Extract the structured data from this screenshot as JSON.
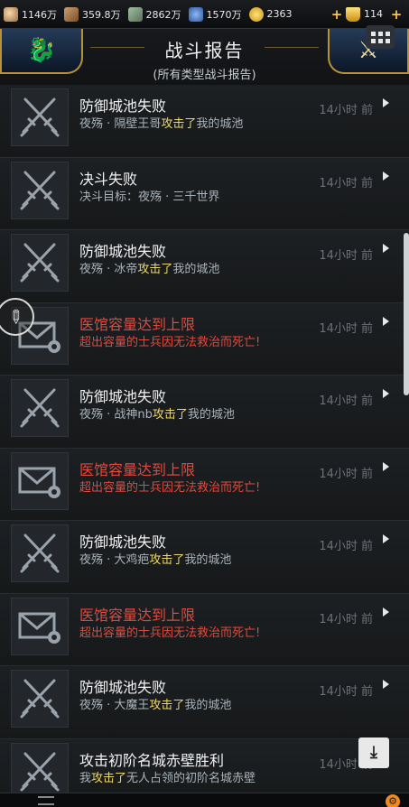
{
  "resources": [
    {
      "icon": "food-icon",
      "value": "1146万"
    },
    {
      "icon": "wood-icon",
      "value": "359.8万"
    },
    {
      "icon": "stone-icon",
      "value": "2862万"
    },
    {
      "icon": "iron-icon",
      "value": "1570万"
    },
    {
      "icon": "gold-coin-icon",
      "value": "2363"
    }
  ],
  "premium": {
    "value": "114"
  },
  "header": {
    "title": "战斗报告",
    "subtitle": "(所有类型战斗报告)"
  },
  "reports": [
    {
      "type": "battle",
      "title": "防御城池失败",
      "pre": "夜殇 · 隔壁王哥",
      "mid": "攻击了",
      "post": "我的城池",
      "time": "14小时  前"
    },
    {
      "type": "battle",
      "title": "决斗失败",
      "pre": "决斗目标：夜殇 · 三千世界",
      "mid": "",
      "post": "",
      "time": "14小时  前"
    },
    {
      "type": "battle",
      "title": "防御城池失败",
      "pre": "夜殇 · 冰帝",
      "mid": "攻击了",
      "post": "我的城池",
      "time": "14小时  前"
    },
    {
      "type": "mail",
      "title": "医馆容量达到上限",
      "pre": "超出容量的士兵因无法救治而死亡!",
      "mid": "",
      "post": "",
      "time": "14小时  前"
    },
    {
      "type": "battle",
      "title": "防御城池失败",
      "pre": "夜殇 · 战神nb",
      "mid": "攻击了",
      "post": "我的城池",
      "time": "14小时  前"
    },
    {
      "type": "mail",
      "title": "医馆容量达到上限",
      "pre": "超出容量的士兵因无法救治而死亡!",
      "mid": "",
      "post": "",
      "time": "14小时  前"
    },
    {
      "type": "battle",
      "title": "防御城池失败",
      "pre": "夜殇 · 大鸡疤",
      "mid": "攻击了",
      "post": "我的城池",
      "time": "14小时  前"
    },
    {
      "type": "mail",
      "title": "医馆容量达到上限",
      "pre": "超出容量的士兵因无法救治而死亡!",
      "mid": "",
      "post": "",
      "time": "14小时  前"
    },
    {
      "type": "battle",
      "title": "防御城池失败",
      "pre": "夜殇 · 大魔王",
      "mid": "攻击了",
      "post": "我的城池",
      "time": "14小时  前"
    },
    {
      "type": "battle",
      "title": "攻击初阶名城赤壁胜利",
      "pre": "我",
      "mid": "攻击了",
      "post": "无人占领的初阶名城赤壁",
      "time": "14小时  前"
    }
  ],
  "colors": {
    "highlight": "#ecd86a",
    "alert": "#e04a3e",
    "gold_trim": "#b8913c"
  }
}
